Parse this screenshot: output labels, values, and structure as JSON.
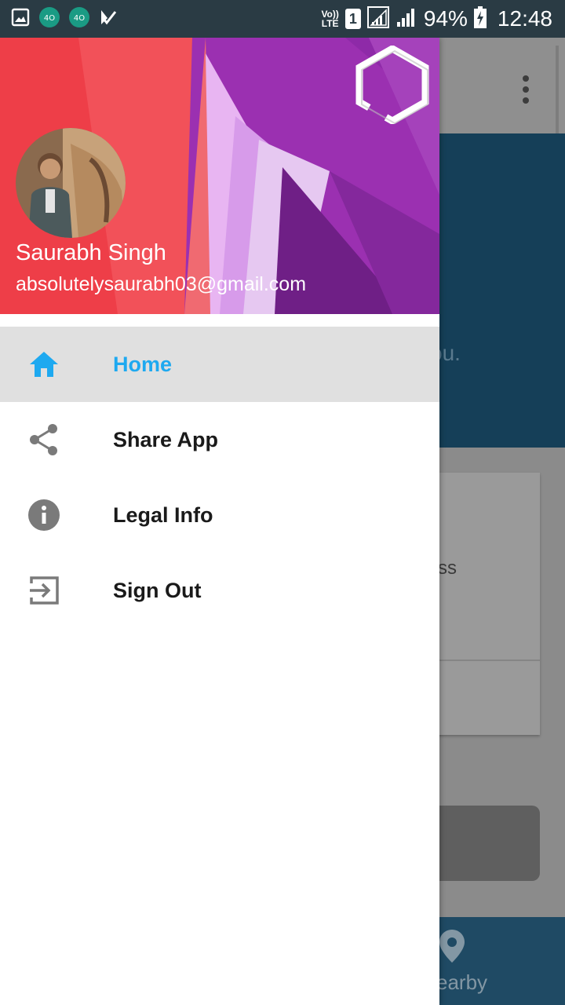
{
  "status_bar": {
    "icons": [
      "gallery-icon",
      "notification-app-icon",
      "notification-app-icon",
      "play-store-icon"
    ],
    "network_label_top": "Vo))",
    "network_label_bottom": "LTE",
    "sim_label": "1",
    "battery": "94%",
    "time": "12:48"
  },
  "drawer": {
    "user_name": "Saurabh Singh",
    "user_email": "absolutelysaurabh03@gmail.com",
    "menu": [
      {
        "label": "Home",
        "icon": "home-icon",
        "active": true
      },
      {
        "label": "Share App",
        "icon": "share-icon",
        "active": false
      },
      {
        "label": "Legal Info",
        "icon": "info-icon",
        "active": false
      },
      {
        "label": "Sign Out",
        "icon": "sign-out-icon",
        "active": false
      }
    ]
  },
  "background_app": {
    "hero_text_fragment": "ou.",
    "card_text_fragment": "ss",
    "nav_label_fragment": "earby"
  },
  "colors": {
    "status_bar": "#2a3b44",
    "active_accent": "#1ea9f0",
    "active_row": "#e0e0e0",
    "hero_bg": "#153f58"
  }
}
